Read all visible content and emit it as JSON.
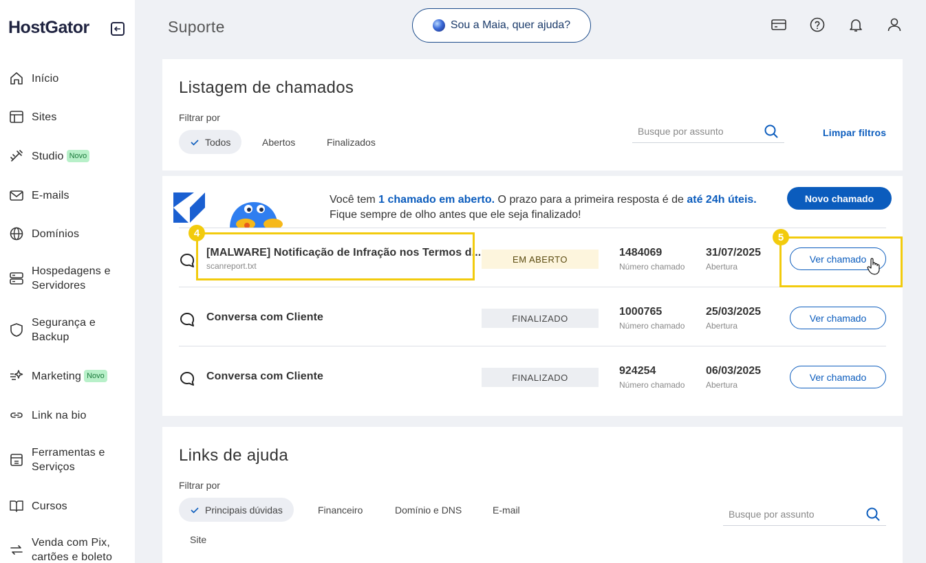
{
  "brand": {
    "logo": "HostGator"
  },
  "sidebar": {
    "items": [
      {
        "label": "Início",
        "icon": "home-icon"
      },
      {
        "label": "Sites",
        "icon": "layout-icon"
      },
      {
        "label": "Studio",
        "icon": "studio-icon",
        "badge": "Novo"
      },
      {
        "label": "E-mails",
        "icon": "mail-icon"
      },
      {
        "label": "Domínios",
        "icon": "globe-icon"
      },
      {
        "label": "Hospedagens e Servidores",
        "icon": "server-icon"
      },
      {
        "label": "Segurança e Backup",
        "icon": "shield-icon"
      },
      {
        "label": "Marketing",
        "icon": "marketing-icon",
        "badge": "Novo"
      },
      {
        "label": "Link na bio",
        "icon": "link-icon"
      },
      {
        "label": "Ferramentas e Serviços",
        "icon": "tools-icon"
      },
      {
        "label": "Cursos",
        "icon": "book-icon"
      },
      {
        "label": "Venda com Pix, cartões e boleto",
        "icon": "payment-icon"
      }
    ]
  },
  "header": {
    "title": "Suporte",
    "maia_label": "Sou a Maia, quer ajuda?"
  },
  "tickets": {
    "title": "Listagem de chamados",
    "filter_label": "Filtrar por",
    "filters": [
      "Todos",
      "Abertos",
      "Finalizados"
    ],
    "active_filter": "Todos",
    "search_placeholder": "Busque por assunto",
    "clear_filters": "Limpar filtros",
    "banner": {
      "line1_a": "Você tem ",
      "line1_b": "1 chamado em aberto.",
      "line1_c": " O prazo para a primeira resposta é de ",
      "line1_d": "até 24h úteis.",
      "line2": "Fique sempre de olho antes que ele seja finalizado!"
    },
    "new_ticket_label": "Novo chamado",
    "number_label": "Número chamado",
    "date_label": "Abertura",
    "view_label": "Ver chamado",
    "rows": [
      {
        "subject": "[MALWARE] Notificação de Infração nos Termos d...",
        "file": "scanreport.txt",
        "status": "EM ABERTO",
        "number": "1484069",
        "date": "31/07/2025"
      },
      {
        "subject": "Conversa com Cliente",
        "file": "",
        "status": "FINALIZADO",
        "number": "1000765",
        "date": "25/03/2025"
      },
      {
        "subject": "Conversa com Cliente",
        "file": "",
        "status": "FINALIZADO",
        "number": "924254",
        "date": "06/03/2025"
      }
    ]
  },
  "help": {
    "title": "Links de ajuda",
    "filter_label": "Filtrar por",
    "filters": [
      "Principais dúvidas",
      "Financeiro",
      "Domínio e DNS",
      "E-mail",
      "Site"
    ],
    "active_filter": "Principais dúvidas",
    "search_placeholder": "Busque por assunto"
  },
  "annotations": {
    "step4": "4",
    "step5": "5"
  },
  "colors": {
    "accent": "#0b5cbd",
    "highlight": "#f2cb0d",
    "open_status_bg": "#fdf5dd"
  }
}
